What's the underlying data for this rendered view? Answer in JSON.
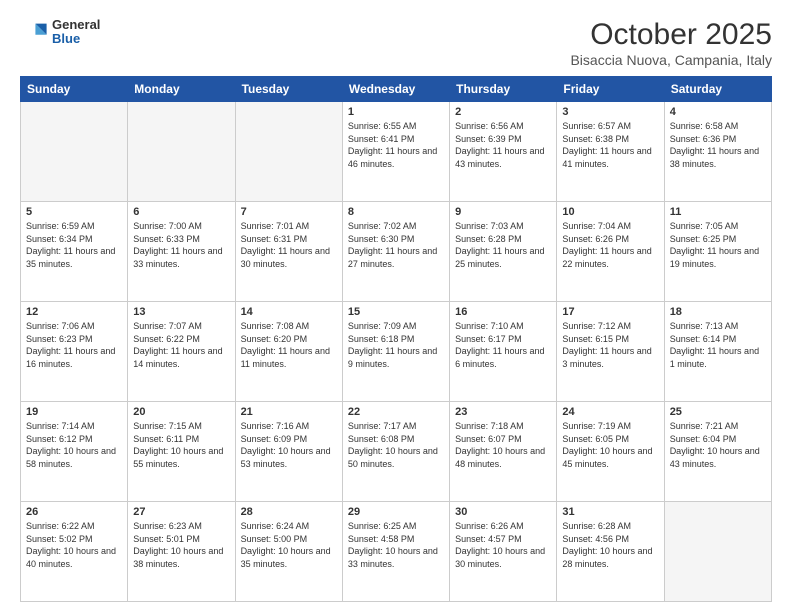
{
  "header": {
    "logo_general": "General",
    "logo_blue": "Blue",
    "month_title": "October 2025",
    "location": "Bisaccia Nuova, Campania, Italy"
  },
  "weekdays": [
    "Sunday",
    "Monday",
    "Tuesday",
    "Wednesday",
    "Thursday",
    "Friday",
    "Saturday"
  ],
  "weeks": [
    [
      {
        "day": "",
        "info": ""
      },
      {
        "day": "",
        "info": ""
      },
      {
        "day": "",
        "info": ""
      },
      {
        "day": "1",
        "info": "Sunrise: 6:55 AM\nSunset: 6:41 PM\nDaylight: 11 hours\nand 46 minutes."
      },
      {
        "day": "2",
        "info": "Sunrise: 6:56 AM\nSunset: 6:39 PM\nDaylight: 11 hours\nand 43 minutes."
      },
      {
        "day": "3",
        "info": "Sunrise: 6:57 AM\nSunset: 6:38 PM\nDaylight: 11 hours\nand 41 minutes."
      },
      {
        "day": "4",
        "info": "Sunrise: 6:58 AM\nSunset: 6:36 PM\nDaylight: 11 hours\nand 38 minutes."
      }
    ],
    [
      {
        "day": "5",
        "info": "Sunrise: 6:59 AM\nSunset: 6:34 PM\nDaylight: 11 hours\nand 35 minutes."
      },
      {
        "day": "6",
        "info": "Sunrise: 7:00 AM\nSunset: 6:33 PM\nDaylight: 11 hours\nand 33 minutes."
      },
      {
        "day": "7",
        "info": "Sunrise: 7:01 AM\nSunset: 6:31 PM\nDaylight: 11 hours\nand 30 minutes."
      },
      {
        "day": "8",
        "info": "Sunrise: 7:02 AM\nSunset: 6:30 PM\nDaylight: 11 hours\nand 27 minutes."
      },
      {
        "day": "9",
        "info": "Sunrise: 7:03 AM\nSunset: 6:28 PM\nDaylight: 11 hours\nand 25 minutes."
      },
      {
        "day": "10",
        "info": "Sunrise: 7:04 AM\nSunset: 6:26 PM\nDaylight: 11 hours\nand 22 minutes."
      },
      {
        "day": "11",
        "info": "Sunrise: 7:05 AM\nSunset: 6:25 PM\nDaylight: 11 hours\nand 19 minutes."
      }
    ],
    [
      {
        "day": "12",
        "info": "Sunrise: 7:06 AM\nSunset: 6:23 PM\nDaylight: 11 hours\nand 16 minutes."
      },
      {
        "day": "13",
        "info": "Sunrise: 7:07 AM\nSunset: 6:22 PM\nDaylight: 11 hours\nand 14 minutes."
      },
      {
        "day": "14",
        "info": "Sunrise: 7:08 AM\nSunset: 6:20 PM\nDaylight: 11 hours\nand 11 minutes."
      },
      {
        "day": "15",
        "info": "Sunrise: 7:09 AM\nSunset: 6:18 PM\nDaylight: 11 hours\nand 9 minutes."
      },
      {
        "day": "16",
        "info": "Sunrise: 7:10 AM\nSunset: 6:17 PM\nDaylight: 11 hours\nand 6 minutes."
      },
      {
        "day": "17",
        "info": "Sunrise: 7:12 AM\nSunset: 6:15 PM\nDaylight: 11 hours\nand 3 minutes."
      },
      {
        "day": "18",
        "info": "Sunrise: 7:13 AM\nSunset: 6:14 PM\nDaylight: 11 hours\nand 1 minute."
      }
    ],
    [
      {
        "day": "19",
        "info": "Sunrise: 7:14 AM\nSunset: 6:12 PM\nDaylight: 10 hours\nand 58 minutes."
      },
      {
        "day": "20",
        "info": "Sunrise: 7:15 AM\nSunset: 6:11 PM\nDaylight: 10 hours\nand 55 minutes."
      },
      {
        "day": "21",
        "info": "Sunrise: 7:16 AM\nSunset: 6:09 PM\nDaylight: 10 hours\nand 53 minutes."
      },
      {
        "day": "22",
        "info": "Sunrise: 7:17 AM\nSunset: 6:08 PM\nDaylight: 10 hours\nand 50 minutes."
      },
      {
        "day": "23",
        "info": "Sunrise: 7:18 AM\nSunset: 6:07 PM\nDaylight: 10 hours\nand 48 minutes."
      },
      {
        "day": "24",
        "info": "Sunrise: 7:19 AM\nSunset: 6:05 PM\nDaylight: 10 hours\nand 45 minutes."
      },
      {
        "day": "25",
        "info": "Sunrise: 7:21 AM\nSunset: 6:04 PM\nDaylight: 10 hours\nand 43 minutes."
      }
    ],
    [
      {
        "day": "26",
        "info": "Sunrise: 6:22 AM\nSunset: 5:02 PM\nDaylight: 10 hours\nand 40 minutes."
      },
      {
        "day": "27",
        "info": "Sunrise: 6:23 AM\nSunset: 5:01 PM\nDaylight: 10 hours\nand 38 minutes."
      },
      {
        "day": "28",
        "info": "Sunrise: 6:24 AM\nSunset: 5:00 PM\nDaylight: 10 hours\nand 35 minutes."
      },
      {
        "day": "29",
        "info": "Sunrise: 6:25 AM\nSunset: 4:58 PM\nDaylight: 10 hours\nand 33 minutes."
      },
      {
        "day": "30",
        "info": "Sunrise: 6:26 AM\nSunset: 4:57 PM\nDaylight: 10 hours\nand 30 minutes."
      },
      {
        "day": "31",
        "info": "Sunrise: 6:28 AM\nSunset: 4:56 PM\nDaylight: 10 hours\nand 28 minutes."
      },
      {
        "day": "",
        "info": ""
      }
    ]
  ]
}
